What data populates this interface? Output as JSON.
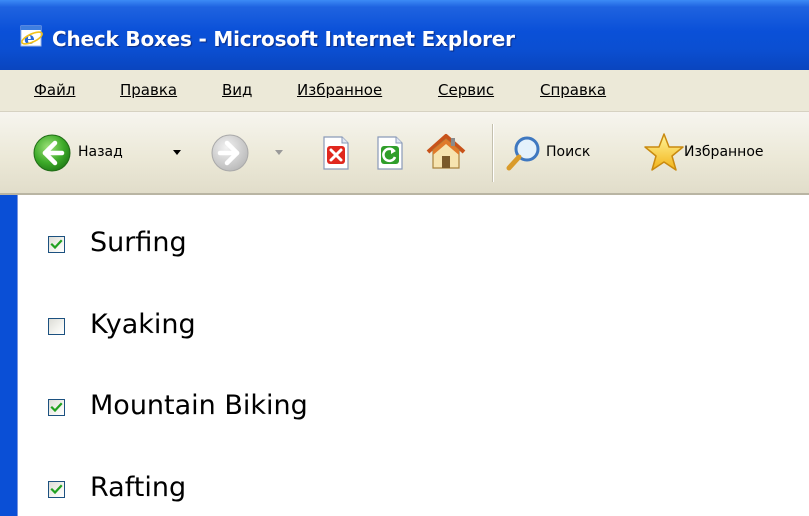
{
  "window": {
    "title": "Check Boxes - Microsoft Internet Explorer"
  },
  "menu": [
    {
      "label": "Файл"
    },
    {
      "label": "Правка"
    },
    {
      "label": "Вид"
    },
    {
      "label": "Избранное"
    },
    {
      "label": "Сервис"
    },
    {
      "label": "Справка"
    }
  ],
  "toolbar": {
    "back_label": "Назад",
    "search_label": "Поиск",
    "favorites_label": "Избранное"
  },
  "checkboxes": [
    {
      "label": "Surfing",
      "checked": true
    },
    {
      "label": "Kyaking",
      "checked": false
    },
    {
      "label": "Mountain Biking",
      "checked": true
    },
    {
      "label": "Rafting",
      "checked": true
    }
  ],
  "colors": {
    "titlebar": "#0a50d8",
    "checkmark": "#21a121"
  }
}
